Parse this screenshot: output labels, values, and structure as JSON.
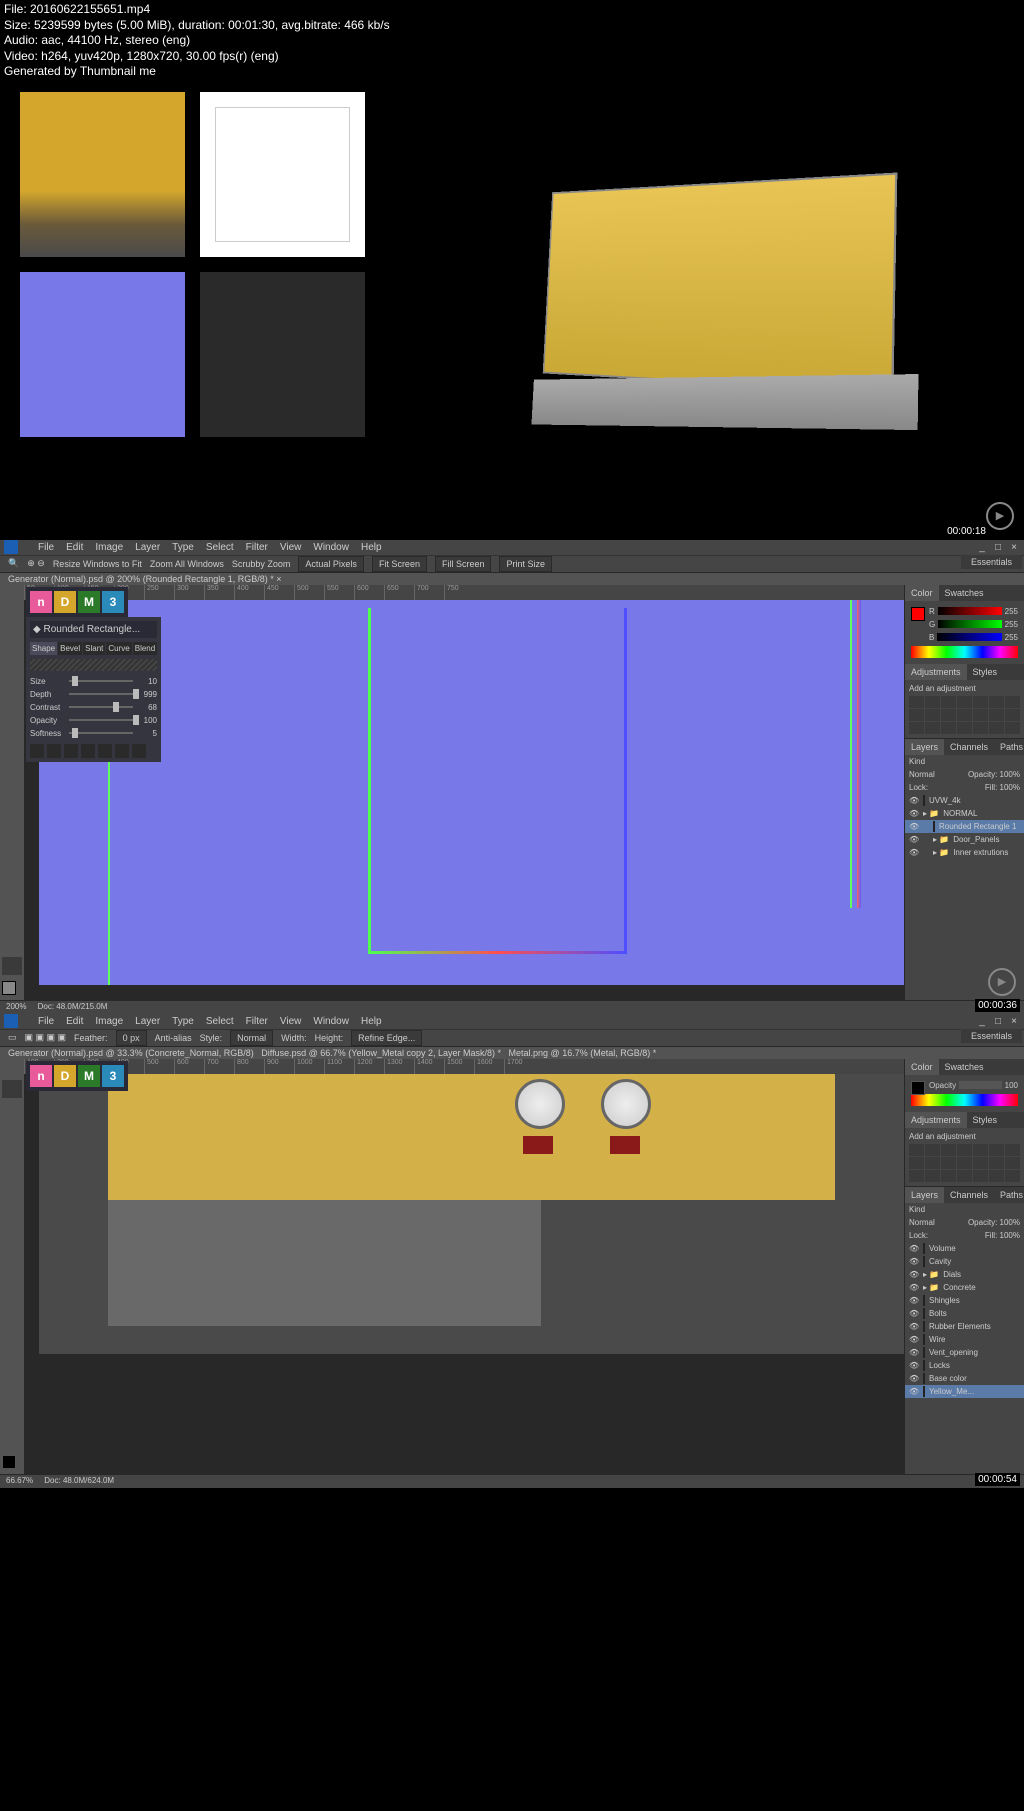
{
  "info": {
    "file": "File: 20160622155651.mp4",
    "size": "Size: 5239599 bytes (5.00 MiB), duration: 00:01:30, avg.bitrate: 466 kb/s",
    "audio": "Audio: aac, 44100 Hz, stereo (eng)",
    "video": "Video: h264, yuv420p, 1280x720, 30.00 fps(r) (eng)",
    "gen": "Generated by Thumbnail me"
  },
  "timestamps": {
    "t1": "00:00:18",
    "t2": "00:00:36",
    "t3": "00:00:54"
  },
  "ps": {
    "menu": [
      "File",
      "Edit",
      "Image",
      "Layer",
      "Type",
      "Select",
      "Filter",
      "View",
      "Window",
      "Help"
    ],
    "essentials": "Essentials",
    "options1": {
      "resize": "Resize Windows to Fit",
      "zoom_all": "Zoom All Windows",
      "scrubby": "Scrubby Zoom",
      "actual": "Actual Pixels",
      "fit": "Fit Screen",
      "fill": "Fill Screen",
      "print": "Print Size"
    },
    "tab1": "Generator (Normal).psd @ 200% (Rounded Rectangle 1, RGB/8) *",
    "tab2a": "Generator (Normal).psd @ 33.3% (Concrete_Normal, RGB/8)",
    "tab2b": "Diffuse.psd @ 66.7% (Yellow_Metal copy 2, Layer Mask/8) *",
    "tab2c": "Metal.png @ 16.7% (Metal, RGB/8) *",
    "status1_zoom": "200%",
    "status1_doc": "Doc: 48.0M/215.0M",
    "status2_zoom": "66.67%",
    "status2_doc": "Doc: 48.0M/624.0M",
    "options2": {
      "feather": "Feather:",
      "feather_val": "0 px",
      "antialias": "Anti-alias",
      "style": "Style:",
      "style_val": "Normal",
      "width": "Width:",
      "height": "Height:",
      "refine": "Refine Edge..."
    },
    "ruler": [
      "50",
      "100",
      "150",
      "200",
      "250",
      "300",
      "350",
      "400",
      "450",
      "500",
      "550",
      "600",
      "650",
      "700",
      "750"
    ],
    "ruler2": [
      "100",
      "200",
      "300",
      "400",
      "500",
      "600",
      "700",
      "800",
      "900",
      "1000",
      "1100",
      "1200",
      "1300",
      "1400",
      "1500",
      "1600",
      "1700"
    ]
  },
  "ndo": {
    "title": "Rounded Rectangle...",
    "tabs": [
      "Shape",
      "Bevel",
      "Slant",
      "Curve",
      "Blend"
    ],
    "sliders": [
      {
        "name": "Size",
        "val": "10",
        "pos": 5
      },
      {
        "name": "Depth",
        "val": "999",
        "pos": 100
      },
      {
        "name": "Contrast",
        "val": "68",
        "pos": 68
      },
      {
        "name": "Opacity",
        "val": "100",
        "pos": 100
      },
      {
        "name": "Softness",
        "val": "5",
        "pos": 5
      }
    ]
  },
  "panels": {
    "color": "Color",
    "swatches": "Swatches",
    "r_val": "255",
    "g_val": "255",
    "b_val": "255",
    "adjustments": "Adjustments",
    "styles": "Styles",
    "add_adj": "Add an adjustment",
    "layers": "Layers",
    "channels": "Channels",
    "paths": "Paths",
    "kind": "Kind",
    "blend": "Normal",
    "opacity_lbl": "Opacity:",
    "opacity_val": "100%",
    "lock": "Lock:",
    "fill_lbl": "Fill:",
    "fill_val": "100%"
  },
  "layers1": [
    {
      "name": "UVW_4k",
      "thumb": "#777"
    },
    {
      "name": "NORMAL",
      "thumb": "#7878e8",
      "folder": true
    },
    {
      "name": "Rounded Rectangle 1",
      "thumb": "#7878e8",
      "selected": true,
      "indent": 1
    },
    {
      "name": "Door_Panels",
      "thumb": "",
      "folder": true,
      "indent": 1
    },
    {
      "name": "Inner extrutions",
      "thumb": "",
      "folder": true,
      "indent": 1
    }
  ],
  "layers2": [
    {
      "name": "Volume",
      "thumb": "#fff"
    },
    {
      "name": "Cavity",
      "thumb": "#d4b048"
    },
    {
      "name": "Dials",
      "folder": true
    },
    {
      "name": "Concrete",
      "folder": true
    },
    {
      "name": "Shingles",
      "thumb": "#222"
    },
    {
      "name": "Bolts",
      "thumb": "#fff"
    },
    {
      "name": "Rubber Elements",
      "thumb": "#222"
    },
    {
      "name": "Wire",
      "thumb": "#fff"
    },
    {
      "name": "Vent_opening",
      "thumb": "#222"
    },
    {
      "name": "Locks",
      "thumb": "#fff"
    },
    {
      "name": "Base color",
      "thumb": "#d4b048"
    },
    {
      "name": "Yellow_Me...",
      "thumb": "#d4b048",
      "selected": true
    }
  ],
  "color2": {
    "opacity_val": "100"
  }
}
